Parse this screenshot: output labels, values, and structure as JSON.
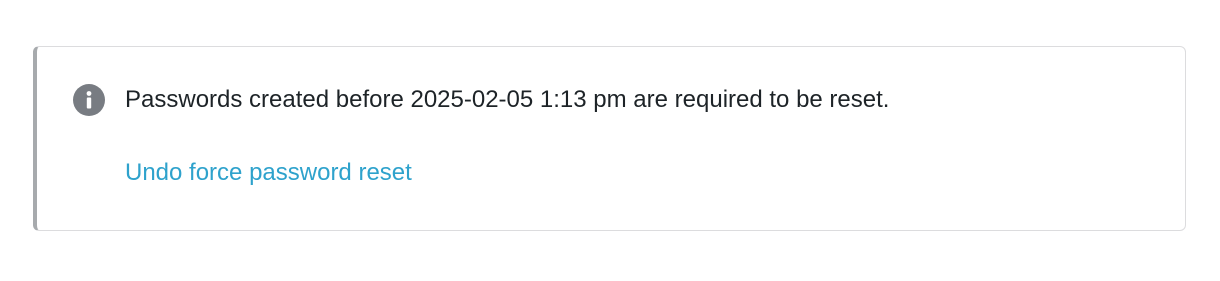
{
  "notice": {
    "icon": "info-icon",
    "message": "Passwords created before 2025-02-05 1:13 pm are required to be reset.",
    "undo_link_label": "Undo force password reset",
    "colors": {
      "accent_border": "#a7aaad",
      "icon_background": "#787c82",
      "link": "#2ea2cc",
      "text": "#1d2327"
    }
  }
}
